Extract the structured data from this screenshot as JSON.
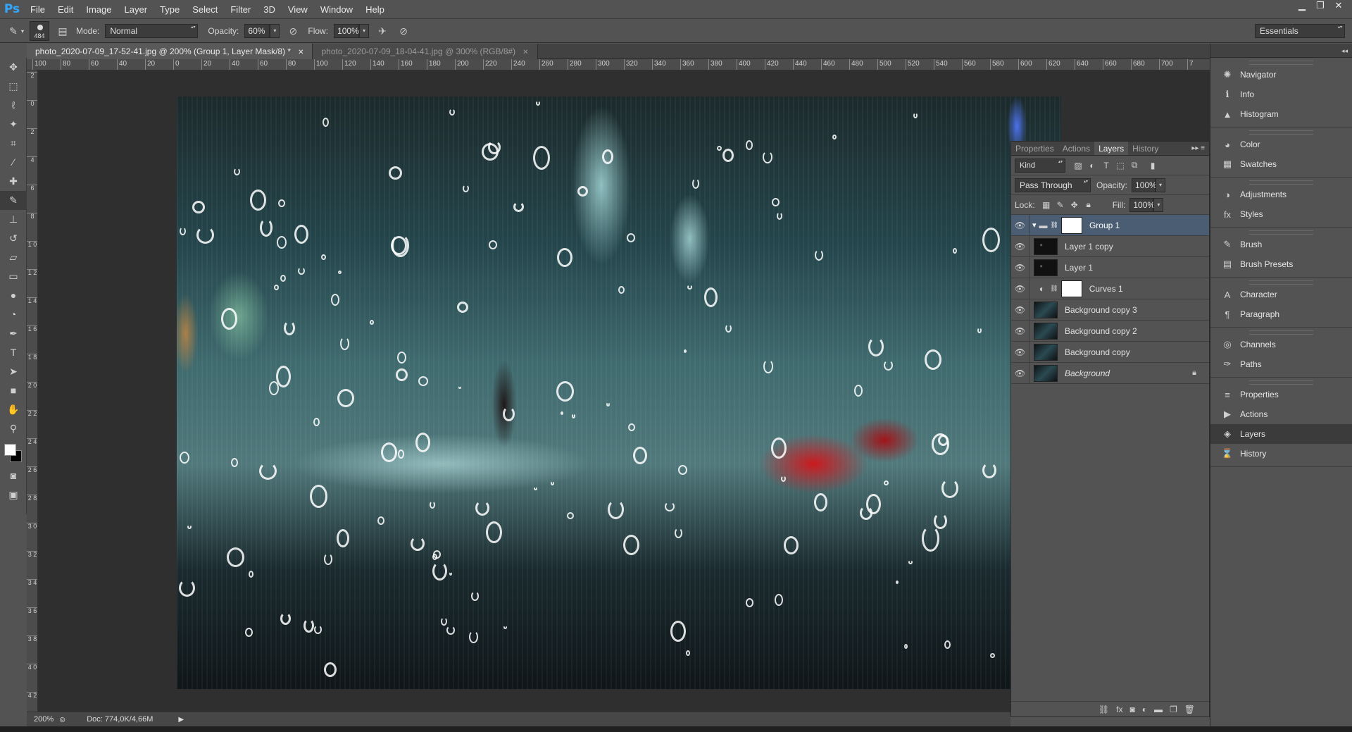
{
  "app": {
    "logo": "Ps"
  },
  "menu": [
    "File",
    "Edit",
    "Image",
    "Layer",
    "Type",
    "Select",
    "Filter",
    "3D",
    "View",
    "Window",
    "Help"
  ],
  "window_controls": [
    "minimize-icon",
    "restore-icon",
    "close-icon"
  ],
  "options": {
    "brush_size": "484",
    "mode_label": "Mode:",
    "mode_value": "Normal",
    "opacity_label": "Opacity:",
    "opacity_value": "60%",
    "flow_label": "Flow:",
    "flow_value": "100%",
    "workspace": "Essentials"
  },
  "tabs": [
    {
      "label": "photo_2020-07-09_17-52-41.jpg @ 200% (Group 1, Layer Mask/8) *",
      "active": true
    },
    {
      "label": "photo_2020-07-09_18-04-41.jpg @ 300% (RGB/8#)",
      "active": false
    }
  ],
  "ruler_top": [
    "100",
    "80",
    "60",
    "40",
    "20",
    "0",
    "20",
    "40",
    "60",
    "80",
    "100",
    "120",
    "140",
    "160",
    "180",
    "200",
    "220",
    "240",
    "260",
    "280",
    "300",
    "320",
    "340",
    "360",
    "380",
    "400",
    "420",
    "440",
    "460",
    "480",
    "500",
    "520",
    "540",
    "560",
    "580",
    "600",
    "620",
    "640",
    "660",
    "680",
    "700",
    "7"
  ],
  "ruler_left": [
    "2",
    "0",
    "2",
    "4",
    "6",
    "8",
    "1 0",
    "1 2",
    "1 4",
    "1 6",
    "1 8",
    "2 0",
    "2 2",
    "2 4",
    "2 6",
    "2 8",
    "3 0",
    "3 2",
    "3 4",
    "3 6",
    "3 8",
    "4 0",
    "4 2"
  ],
  "dock": [
    [
      {
        "icon": "navigator-icon",
        "label": "Navigator"
      },
      {
        "icon": "info-icon",
        "label": "Info"
      },
      {
        "icon": "histogram-icon",
        "label": "Histogram"
      }
    ],
    [
      {
        "icon": "color-icon",
        "label": "Color"
      },
      {
        "icon": "swatches-icon",
        "label": "Swatches"
      }
    ],
    [
      {
        "icon": "adjustments-icon",
        "label": "Adjustments"
      },
      {
        "icon": "styles-icon",
        "label": "Styles"
      }
    ],
    [
      {
        "icon": "brush-icon",
        "label": "Brush"
      },
      {
        "icon": "brush-presets-icon",
        "label": "Brush Presets"
      }
    ],
    [
      {
        "icon": "character-icon",
        "label": "Character"
      },
      {
        "icon": "paragraph-icon",
        "label": "Paragraph"
      }
    ],
    [
      {
        "icon": "channels-icon",
        "label": "Channels"
      },
      {
        "icon": "paths-icon",
        "label": "Paths"
      }
    ],
    [
      {
        "icon": "properties-icon",
        "label": "Properties"
      },
      {
        "icon": "actions-icon",
        "label": "Actions"
      },
      {
        "icon": "layers-icon",
        "label": "Layers",
        "active": true
      },
      {
        "icon": "history-icon",
        "label": "History"
      }
    ]
  ],
  "layers_panel": {
    "tabs": [
      "Properties",
      "Actions",
      "Layers",
      "History"
    ],
    "active_tab": "Layers",
    "filter_kind": "Kind",
    "blend_mode": "Pass Through",
    "opacity_label": "Opacity:",
    "opacity_value": "100%",
    "lock_label": "Lock:",
    "fill_label": "Fill:",
    "fill_value": "100%",
    "layers": [
      {
        "name": "Group 1",
        "type": "group",
        "selected": true
      },
      {
        "name": "Layer 1 copy",
        "type": "pixel"
      },
      {
        "name": "Layer 1",
        "type": "pixel"
      },
      {
        "name": "Curves 1",
        "type": "adjustment"
      },
      {
        "name": "Background copy 3",
        "type": "photo"
      },
      {
        "name": "Background copy 2",
        "type": "photo"
      },
      {
        "name": "Background copy",
        "type": "photo"
      },
      {
        "name": "Background",
        "type": "photo",
        "locked": true,
        "italic": true
      }
    ],
    "footer_icons": [
      "link-layers-icon",
      "fx-icon",
      "add-mask-icon",
      "adjustment-layer-icon",
      "new-group-icon",
      "new-layer-icon",
      "delete-layer-icon"
    ]
  },
  "status": {
    "zoom": "200%",
    "doc": "Doc: 774,0K/4,66M"
  }
}
